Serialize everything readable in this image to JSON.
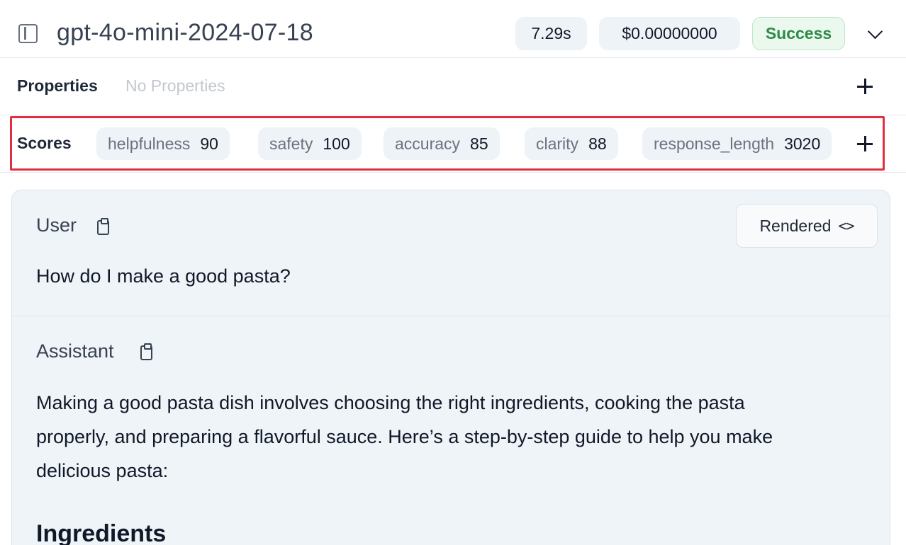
{
  "header": {
    "model": "gpt-4o-mini-2024-07-18",
    "latency": "7.29s",
    "cost": "$0.00000000",
    "status": "Success",
    "status_color": "#2e8a46"
  },
  "properties": {
    "label": "Properties",
    "empty_text": "No Properties"
  },
  "scores": {
    "label": "Scores",
    "highlight_color": "#e0303f",
    "items": [
      {
        "key": "helpfulness",
        "value": "90"
      },
      {
        "key": "safety",
        "value": "100"
      },
      {
        "key": "accuracy",
        "value": "85"
      },
      {
        "key": "clarity",
        "value": "88"
      },
      {
        "key": "response_length",
        "value": "3020"
      }
    ]
  },
  "messages": {
    "view_toggle_label": "Rendered",
    "view_toggle_icon": "<>",
    "user": {
      "role": "User",
      "text": "How do I make a good pasta?"
    },
    "assistant": {
      "role": "Assistant",
      "lines": [
        "Making a good pasta dish involves choosing the right ingredients, cooking the pasta",
        "properly, and preparing a flavorful sauce. Here’s a step-by-step guide to help you make",
        "delicious pasta:"
      ],
      "heading": "Ingredients"
    }
  },
  "icons": {
    "panel": "sidebar-toggle-icon",
    "expand": "chevron-down-icon",
    "add": "plus-icon",
    "copy": "clipboard-icon"
  }
}
